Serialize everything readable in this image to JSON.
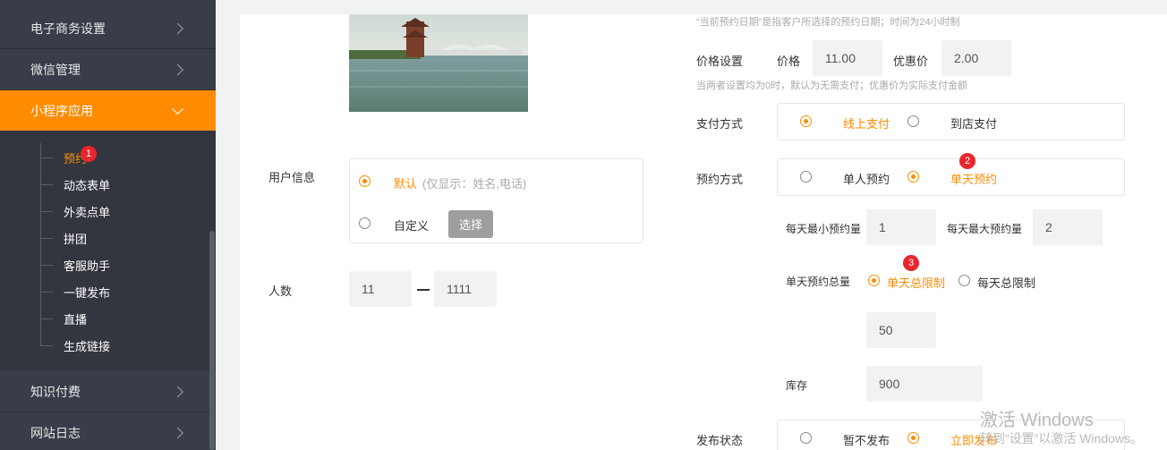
{
  "sidebar": {
    "items": [
      {
        "label": "电子商务设置"
      },
      {
        "label": "微信管理"
      },
      {
        "label": "小程序应用"
      },
      {
        "label": "知识付费"
      },
      {
        "label": "网站日志"
      }
    ],
    "submenu": [
      {
        "label": "预约"
      },
      {
        "label": "动态表单"
      },
      {
        "label": "外卖点单"
      },
      {
        "label": "拼团"
      },
      {
        "label": "客服助手"
      },
      {
        "label": "一键发布"
      },
      {
        "label": "直播"
      },
      {
        "label": "生成链接"
      }
    ],
    "badge": "1"
  },
  "form": {
    "top_hint": "“当前预约日期”是指客户所选择的预约日期；时间为24小时制",
    "user_info": {
      "label": "用户信息",
      "default_label": "默认",
      "default_note": "(仅显示：姓名,电话)",
      "custom_label": "自定义",
      "choose_button": "选择"
    },
    "people": {
      "label": "人数",
      "min": "11",
      "max": "1111"
    },
    "price": {
      "label": "价格设置",
      "price_label": "价格",
      "price_value": "11.00",
      "discount_label": "优惠价",
      "discount_value": "2.00",
      "hint": "当两者设置均为0时，默认为无需支付；优惠价为实际支付金额"
    },
    "payment": {
      "label": "支付方式",
      "options": [
        "线上支付",
        "到店支付"
      ],
      "selected": "线上支付"
    },
    "booking_mode": {
      "label": "预约方式",
      "options": [
        "单人预约",
        "单天预约"
      ],
      "selected": "单天预约",
      "badge": "2"
    },
    "daily": {
      "min_label": "每天最小预约量",
      "min_value": "1",
      "max_label": "每天最大预约量",
      "max_value": "2"
    },
    "total": {
      "label": "单天预约总量",
      "options": [
        "单天总限制",
        "每天总限制"
      ],
      "selected": "单天总限制",
      "value": "50",
      "badge": "3"
    },
    "stock": {
      "label": "库存",
      "value": "900"
    },
    "publish": {
      "label": "发布状态",
      "options": [
        "暂不发布",
        "立即发布"
      ],
      "selected": "立即发布"
    }
  },
  "watermark": {
    "title": "激活 Windows",
    "subtitle": "转到“设置”以激活 Windows。"
  },
  "colors": {
    "accent": "#ff8c00",
    "sidebar_bg": "#393d49",
    "badge": "#e8262d"
  }
}
